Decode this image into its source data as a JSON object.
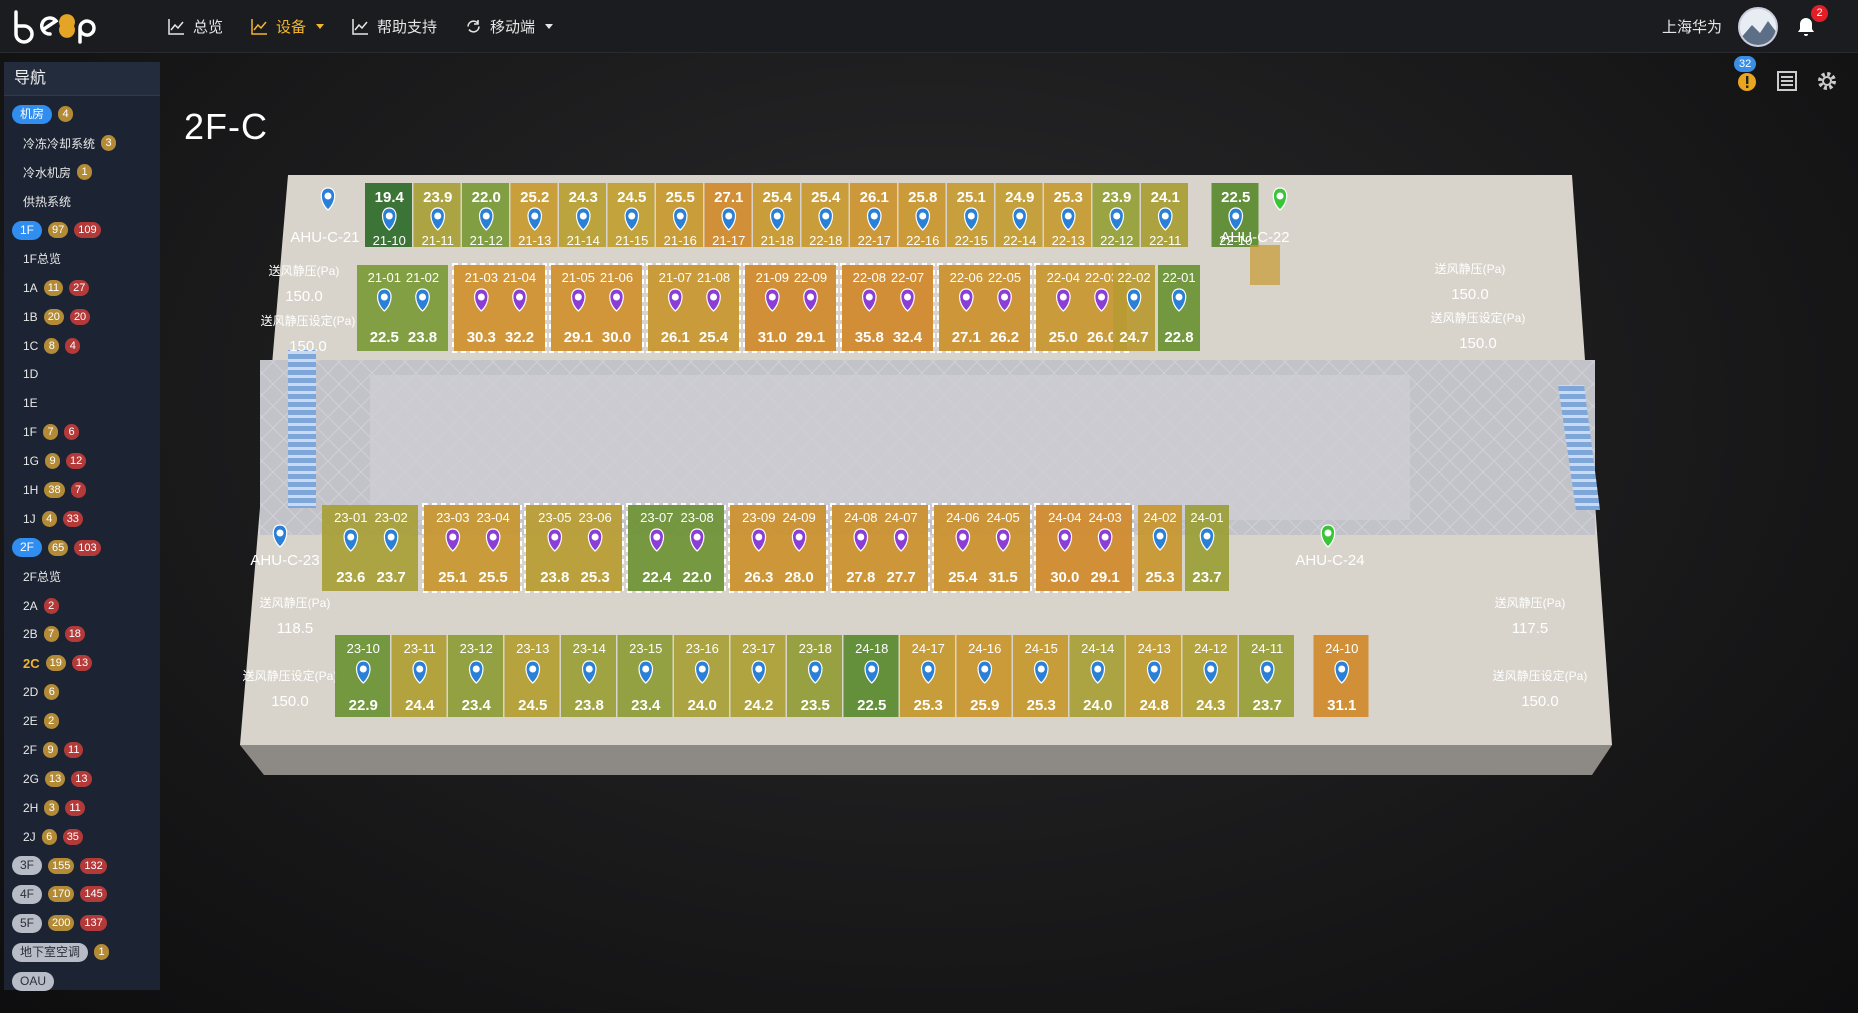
{
  "header": {
    "logo_text": "beep",
    "nav": [
      {
        "label": "总览",
        "icon": "chart-line-icon"
      },
      {
        "label": "设备",
        "icon": "chart-line-icon",
        "active": true,
        "dropdown": true
      },
      {
        "label": "帮助支持",
        "icon": "chart-line-icon"
      },
      {
        "label": "移动端",
        "icon": "refresh-icon",
        "dropdown": true
      }
    ],
    "user_name": "上海华为",
    "notification_count": "2"
  },
  "sidebar": {
    "title": "导航",
    "items": [
      {
        "label": "机房",
        "style": "blue",
        "counts": [
          "4"
        ]
      },
      {
        "label": "冷冻冷却系统",
        "sub": true,
        "counts": [
          "3"
        ]
      },
      {
        "label": "冷水机房",
        "sub": true,
        "counts": [
          "1"
        ]
      },
      {
        "label": "供热系统",
        "sub": true,
        "counts": []
      },
      {
        "label": "1F",
        "style": "blue",
        "counts": [
          "97",
          "109"
        ]
      },
      {
        "label": "1F总览",
        "sub": true,
        "counts": []
      },
      {
        "label": "1A",
        "sub": true,
        "counts": [
          "11",
          "27"
        ]
      },
      {
        "label": "1B",
        "sub": true,
        "counts": [
          "20",
          "20"
        ]
      },
      {
        "label": "1C",
        "sub": true,
        "counts": [
          "8",
          "4"
        ]
      },
      {
        "label": "1D",
        "sub": true,
        "counts": []
      },
      {
        "label": "1E",
        "sub": true,
        "counts": []
      },
      {
        "label": "1F",
        "sub": true,
        "counts": [
          "7",
          "6"
        ]
      },
      {
        "label": "1G",
        "sub": true,
        "counts": [
          "9",
          "12"
        ]
      },
      {
        "label": "1H",
        "sub": true,
        "counts": [
          "38",
          "7"
        ]
      },
      {
        "label": "1J",
        "sub": true,
        "counts": [
          "4",
          "33"
        ]
      },
      {
        "label": "2F",
        "style": "blue",
        "counts": [
          "65",
          "103"
        ]
      },
      {
        "label": "2F总览",
        "sub": true,
        "counts": []
      },
      {
        "label": "2A",
        "sub": true,
        "counts": [
          "",
          "2"
        ]
      },
      {
        "label": "2B",
        "sub": true,
        "counts": [
          "7",
          "18"
        ]
      },
      {
        "label": "2C",
        "sub": true,
        "current": true,
        "counts": [
          "19",
          "13"
        ]
      },
      {
        "label": "2D",
        "sub": true,
        "counts": [
          "6"
        ]
      },
      {
        "label": "2E",
        "sub": true,
        "counts": [
          "2"
        ]
      },
      {
        "label": "2F",
        "sub": true,
        "counts": [
          "9",
          "11"
        ]
      },
      {
        "label": "2G",
        "sub": true,
        "counts": [
          "13",
          "13"
        ]
      },
      {
        "label": "2H",
        "sub": true,
        "counts": [
          "3",
          "11"
        ]
      },
      {
        "label": "2J",
        "sub": true,
        "counts": [
          "6",
          "35"
        ]
      },
      {
        "label": "3F",
        "style": "gray",
        "counts": [
          "155",
          "132"
        ]
      },
      {
        "label": "4F",
        "style": "gray",
        "counts": [
          "170",
          "145"
        ]
      },
      {
        "label": "5F",
        "style": "gray",
        "counts": [
          "200",
          "137"
        ]
      },
      {
        "label": "地下室空调",
        "style": "gray",
        "counts": [
          "1"
        ]
      },
      {
        "label": "OAU",
        "style": "gray",
        "counts": []
      }
    ]
  },
  "toolbar": {
    "alert_count": "32"
  },
  "page": {
    "title": "2F-C"
  },
  "floorplan": {
    "ahu": {
      "c21": "AHU-C-21",
      "c22": "AHU-C-22",
      "c23": "AHU-C-23",
      "c24": "AHU-C-24"
    },
    "pressure_label": "送风静压(Pa)",
    "pressure_set_label": "送风静压设定(Pa)",
    "pressures": {
      "c21": "150.0",
      "c21_set": "150.0",
      "c22": "150.0",
      "c22_set": "150.0",
      "c23": "118.5",
      "c23_set": "150.0",
      "c24": "117.5",
      "c24_set": "150.0"
    },
    "top_row": [
      {
        "id": "21-10",
        "t": "19.4",
        "c": "#2f6a2a"
      },
      {
        "id": "21-11",
        "t": "23.9",
        "c": "#a8a036"
      },
      {
        "id": "21-12",
        "t": "22.0",
        "c": "#7a9a36"
      },
      {
        "id": "21-13",
        "t": "25.2",
        "c": "#c89a30"
      },
      {
        "id": "21-14",
        "t": "24.3",
        "c": "#b8a032"
      },
      {
        "id": "21-15",
        "t": "24.5",
        "c": "#c09e30"
      },
      {
        "id": "21-16",
        "t": "25.5",
        "c": "#c8982e"
      },
      {
        "id": "21-17",
        "t": "27.1",
        "c": "#d08a2a"
      },
      {
        "id": "21-18",
        "t": "25.4",
        "c": "#c8982e"
      },
      {
        "id": "22-18",
        "t": "25.4",
        "c": "#c8982e"
      },
      {
        "id": "22-17",
        "t": "26.1",
        "c": "#cc922c"
      },
      {
        "id": "22-16",
        "t": "25.8",
        "c": "#ca962e"
      },
      {
        "id": "22-15",
        "t": "25.1",
        "c": "#c69a30"
      },
      {
        "id": "22-14",
        "t": "24.9",
        "c": "#c29c30"
      },
      {
        "id": "22-13",
        "t": "25.3",
        "c": "#c69a30"
      },
      {
        "id": "22-12",
        "t": "23.9",
        "c": "#96a036"
      },
      {
        "id": "22-11",
        "t": "24.1",
        "c": "#a89e34"
      },
      {
        "id": "22-10",
        "t": "22.5",
        "c": "#5a8a30"
      }
    ],
    "upper_mid": [
      {
        "ids": [
          "21-01",
          "21-02"
        ],
        "t": [
          "22.5",
          "23.8"
        ],
        "c": "#7c9a38",
        "pin": "blue"
      },
      {
        "ids": [
          "21-03",
          "21-04"
        ],
        "t": [
          "30.3",
          "32.2"
        ],
        "c": "#d0902c",
        "pin": "purple"
      },
      {
        "ids": [
          "21-05",
          "21-06"
        ],
        "t": [
          "29.1",
          "30.0"
        ],
        "c": "#d0902c",
        "pin": "purple"
      },
      {
        "ids": [
          "21-07",
          "21-08"
        ],
        "t": [
          "26.1",
          "25.4"
        ],
        "c": "#c8962e",
        "pin": "purple"
      },
      {
        "ids": [
          "21-09",
          "22-09"
        ],
        "t": [
          "31.0",
          "29.1"
        ],
        "c": "#d08a2a",
        "pin": "purple"
      },
      {
        "ids": [
          "22-08",
          "22-07"
        ],
        "t": [
          "35.8",
          "32.4"
        ],
        "c": "#d0882a",
        "pin": "purple"
      },
      {
        "ids": [
          "22-06",
          "22-05"
        ],
        "t": [
          "27.1",
          "26.2"
        ],
        "c": "#cc902c",
        "pin": "purple"
      },
      {
        "ids": [
          "22-04",
          "22-03"
        ],
        "t": [
          "25.0",
          "26.0"
        ],
        "c": "#c8962e",
        "pin": "purple"
      }
    ],
    "upper_right": [
      {
        "id": "22-02",
        "t": "24.7",
        "c": "#b89a32"
      },
      {
        "id": "22-01",
        "t": "22.8",
        "c": "#6a9234"
      }
    ],
    "lower_mid": [
      {
        "ids": [
          "23-01",
          "23-02"
        ],
        "t": [
          "23.6",
          "23.7"
        ],
        "c": "#a8a036",
        "pin": "blue"
      },
      {
        "ids": [
          "23-03",
          "23-04"
        ],
        "t": [
          "25.1",
          "25.5"
        ],
        "c": "#c8962e",
        "pin": "purple"
      },
      {
        "ids": [
          "23-05",
          "23-06"
        ],
        "t": [
          "23.8",
          "25.3"
        ],
        "c": "#b89c32",
        "pin": "purple"
      },
      {
        "ids": [
          "23-07",
          "23-08"
        ],
        "t": [
          "22.4",
          "22.0"
        ],
        "c": "#6e9234",
        "pin": "purple"
      },
      {
        "ids": [
          "23-09",
          "24-09"
        ],
        "t": [
          "26.3",
          "28.0"
        ],
        "c": "#cc902c",
        "pin": "purple"
      },
      {
        "ids": [
          "24-08",
          "24-07"
        ],
        "t": [
          "27.8",
          "27.7"
        ],
        "c": "#cc902c",
        "pin": "purple"
      },
      {
        "ids": [
          "24-06",
          "24-05"
        ],
        "t": [
          "25.4",
          "31.5"
        ],
        "c": "#cc902c",
        "pin": "purple"
      },
      {
        "ids": [
          "24-04",
          "24-03"
        ],
        "t": [
          "30.0",
          "29.1"
        ],
        "c": "#d08a2a",
        "pin": "purple"
      }
    ],
    "lower_right": [
      {
        "id": "24-02",
        "t": "25.3",
        "c": "#c8962e"
      },
      {
        "id": "24-01",
        "t": "23.7",
        "c": "#9a9e36"
      }
    ],
    "bottom_row": [
      {
        "id": "23-10",
        "t": "22.9",
        "c": "#6a9234"
      },
      {
        "id": "23-11",
        "t": "24.4",
        "c": "#b09e32"
      },
      {
        "id": "23-12",
        "t": "23.4",
        "c": "#8e9c36"
      },
      {
        "id": "23-13",
        "t": "24.5",
        "c": "#b49e32"
      },
      {
        "id": "23-14",
        "t": "23.8",
        "c": "#9a9e36"
      },
      {
        "id": "23-15",
        "t": "23.4",
        "c": "#8e9c36"
      },
      {
        "id": "23-16",
        "t": "24.0",
        "c": "#a8a036"
      },
      {
        "id": "23-17",
        "t": "24.2",
        "c": "#aca034"
      },
      {
        "id": "23-18",
        "t": "23.5",
        "c": "#929c36"
      },
      {
        "id": "24-18",
        "t": "22.5",
        "c": "#5a8a30"
      },
      {
        "id": "24-17",
        "t": "25.3",
        "c": "#c6982e"
      },
      {
        "id": "24-16",
        "t": "25.9",
        "c": "#ca962e"
      },
      {
        "id": "24-15",
        "t": "25.3",
        "c": "#c6982e"
      },
      {
        "id": "24-14",
        "t": "24.0",
        "c": "#a8a036"
      },
      {
        "id": "24-13",
        "t": "24.8",
        "c": "#c09c30"
      },
      {
        "id": "24-12",
        "t": "24.3",
        "c": "#b0a034"
      },
      {
        "id": "24-11",
        "t": "23.7",
        "c": "#989e36"
      },
      {
        "id": "24-10",
        "t": "31.1",
        "c": "#d08a2a"
      }
    ]
  }
}
